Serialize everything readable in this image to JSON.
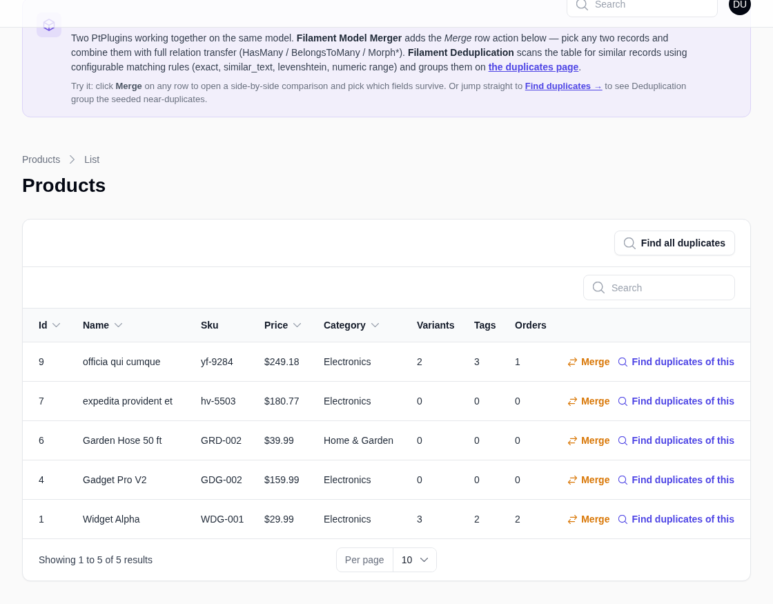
{
  "topbar": {
    "search": {
      "placeholder": "Search"
    },
    "avatar": {
      "initials": "DU"
    }
  },
  "banner": {
    "paragraphs": [
      {
        "kind": "lead",
        "parts": [
          {
            "kind": "text",
            "text": "Two PtPlugins working together on the same model. **Filament Model Merger** adds the *Merge* row action below — pick any two records and combine them with full relation transfer (HasMany / BelongsToMany / Morph"
          },
          {
            "kind": "text",
            "text": "*). "
          },
          {
            "kind": "text",
            "text": "**Filament Deduplication** scans the table for similar records using configurable matching rules (exact, similar_text, levenshtein, numeric range) and groups them on "
          },
          {
            "kind": "link",
            "text": "the duplicates page"
          },
          {
            "kind": "text",
            "text": "."
          }
        ]
      },
      {
        "kind": "hint",
        "parts": [
          {
            "kind": "text",
            "text": "Try it: click **Merge** on any row to open a side-by-side comparison and pick which fields survive. Or jump straight to "
          },
          {
            "kind": "link",
            "text": "Find duplicates →"
          },
          {
            "kind": "text",
            "text": " to see Deduplication group the seeded near-duplicates."
          }
        ]
      }
    ]
  },
  "breadcrumbs": [
    "Products",
    "List"
  ],
  "heading": "Products",
  "table": {
    "header_action": {
      "label": "Find all duplicates"
    },
    "search": {
      "placeholder": "Search"
    },
    "columns": [
      {
        "label": "Id",
        "sortable": true
      },
      {
        "label": "Name",
        "sortable": true
      },
      {
        "label": "Sku",
        "sortable": false
      },
      {
        "label": "Price",
        "sortable": true
      },
      {
        "label": "Category",
        "sortable": true
      },
      {
        "label": "Variants",
        "sortable": false
      },
      {
        "label": "Tags",
        "sortable": false
      },
      {
        "label": "Orders",
        "sortable": false
      }
    ],
    "rows": [
      {
        "cells": [
          "9",
          "officia qui cumque",
          "yf-9284",
          "$249.18",
          "Electronics",
          "2",
          "3",
          "1"
        ],
        "actions": [
          {
            "kind": "merge",
            "label": "Merge"
          },
          {
            "kind": "find",
            "label": "Find duplicates of this"
          }
        ]
      },
      {
        "cells": [
          "7",
          "expedita provident et",
          "hv-5503",
          "$180.77",
          "Electronics",
          "0",
          "0",
          "0"
        ],
        "actions": [
          {
            "kind": "merge",
            "label": "Merge"
          },
          {
            "kind": "find",
            "label": "Find duplicates of this"
          }
        ]
      },
      {
        "cells": [
          "6",
          "Garden Hose 50 ft",
          "GRD-002",
          "$39.99",
          "Home & Garden",
          "0",
          "0",
          "0"
        ],
        "actions": [
          {
            "kind": "merge",
            "label": "Merge"
          },
          {
            "kind": "find",
            "label": "Find duplicates of this"
          }
        ]
      },
      {
        "cells": [
          "4",
          "Gadget Pro V2",
          "GDG-002",
          "$159.99",
          "Electronics",
          "0",
          "0",
          "0"
        ],
        "actions": [
          {
            "kind": "merge",
            "label": "Merge"
          },
          {
            "kind": "find",
            "label": "Find duplicates of this"
          }
        ]
      },
      {
        "cells": [
          "1",
          "Widget Alpha",
          "WDG-001",
          "$29.99",
          "Electronics",
          "3",
          "2",
          "2"
        ],
        "actions": [
          {
            "kind": "merge",
            "label": "Merge"
          },
          {
            "kind": "find",
            "label": "Find duplicates of this"
          }
        ]
      }
    ],
    "footer": {
      "summary": "Showing 1 to 5 of 5 results",
      "per_page": {
        "label": "Per page",
        "value": "10"
      }
    }
  }
}
